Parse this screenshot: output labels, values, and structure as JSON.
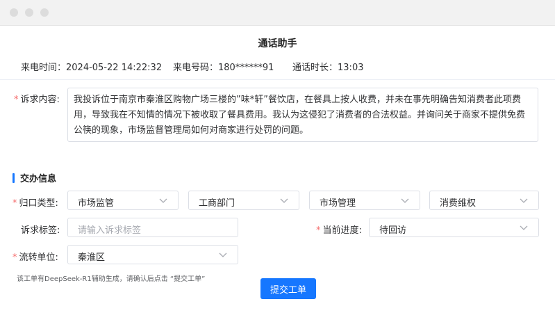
{
  "window": {
    "title": "通话助手"
  },
  "call_info": {
    "time_label": "来电时间：",
    "time_value": "2024-05-22 14:22:32",
    "phone_label": "来电号码：",
    "phone_value": "180******91",
    "duration_label": "通话时长：",
    "duration_value": "13:03"
  },
  "complaint": {
    "label": "诉求内容:",
    "text": "我投诉位于南京市秦淮区购物广场三楼的”味*轩”餐饮店，在餐具上按人收费，并未在事先明确告知消费者此项费用，导致我在不知情的情况下被收取了餐具费用。我认为这侵犯了消费者的合法权益。并询问关于商家不提供免费公筷的现象，市场监督管理局如何对商家进行处罚的问题。"
  },
  "assignment": {
    "section_title": "交办信息",
    "category_label": "归口类型:",
    "category_values": [
      "市场监管",
      "工商部门",
      "市场管理",
      "消费维权"
    ],
    "tag_label": "诉求标签:",
    "tag_placeholder": "请输入诉求标签",
    "progress_label": "当前进度:",
    "progress_value": "待回访",
    "unit_label": "流转单位:",
    "unit_value": "秦淮区"
  },
  "footer": {
    "note": "该工单有DeepSeek-R1辅助生成，请确认后点击 “提交工单”",
    "submit_label": "提交工单"
  },
  "colors": {
    "primary": "#1677ff",
    "required": "#f56c6c"
  }
}
